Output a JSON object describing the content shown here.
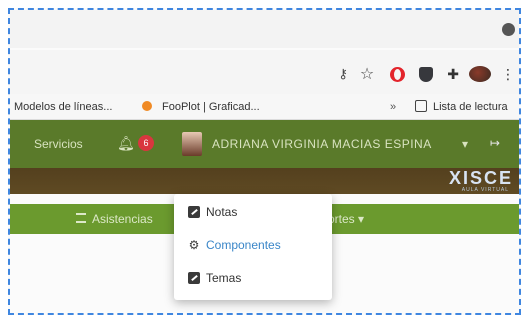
{
  "bookmarks": {
    "item1": "Modelos de líneas...",
    "item2": "FooPlot | Graficad...",
    "chevron": "»",
    "reading_list": "Lista de lectura"
  },
  "header": {
    "services": "Servicios",
    "notification_count": "6",
    "user_name": "ADRIANA VIRGINIA MACIAS ESPINA",
    "user_caret": "▾",
    "logo": "XISCE",
    "logo_sub": "AULA VIRTUAL"
  },
  "nav": {
    "asistencias": "Asistencias",
    "reportes": "ortes ▾"
  },
  "dropdown": {
    "items": [
      {
        "label": "Notas"
      },
      {
        "label": "Componentes"
      },
      {
        "label": "Temas"
      }
    ]
  },
  "colors": {
    "frame": "#3f86e0",
    "header_green": "#5a7a2a",
    "nav_green": "#6b9a2e",
    "accent_blue": "#3a86c8",
    "badge_red": "#d9363e"
  }
}
